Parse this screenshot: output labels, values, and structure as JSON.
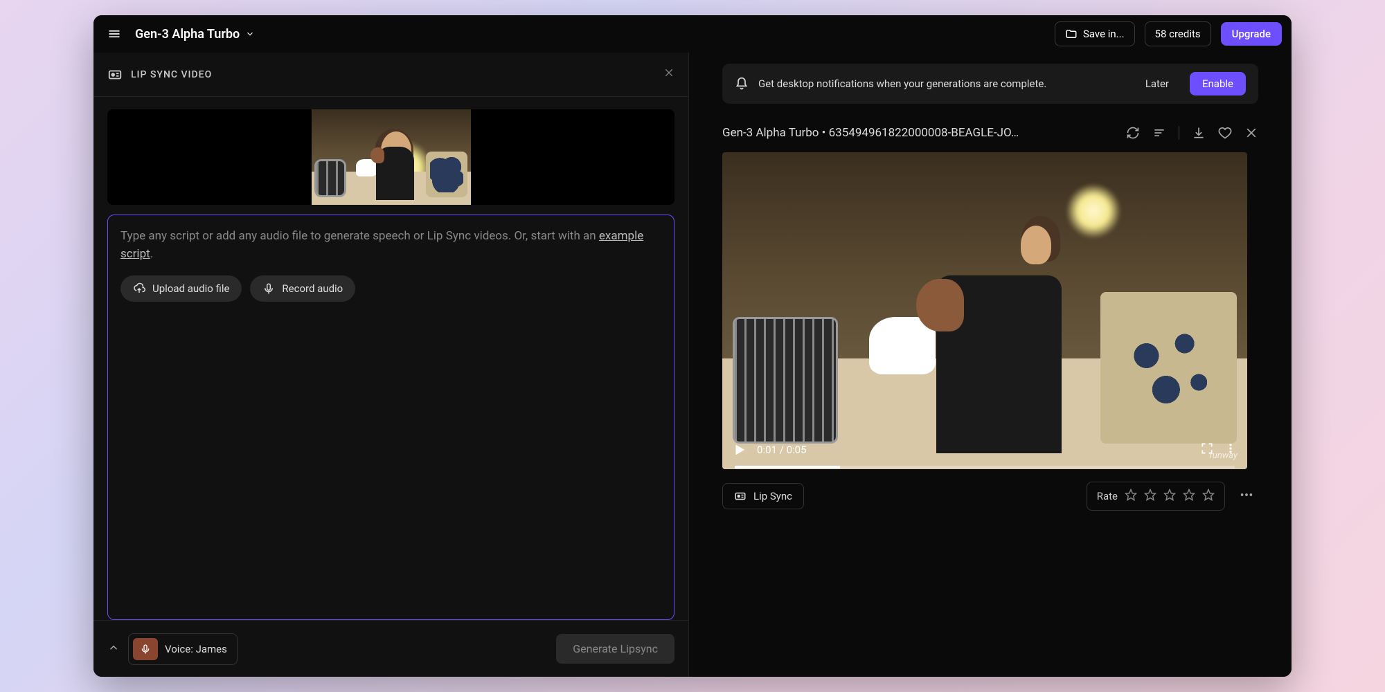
{
  "header": {
    "model": "Gen-3 Alpha Turbo",
    "save_label": "Save in...",
    "credits": "58 credits",
    "upgrade": "Upgrade"
  },
  "left": {
    "panel_title": "LIP SYNC VIDEO",
    "placeholder_pre": "Type any script or add any audio file to generate speech or Lip Sync videos. Or, start with an ",
    "placeholder_link": "example script",
    "placeholder_post": ".",
    "upload_audio": "Upload audio file",
    "record_audio": "Record audio",
    "voice_label": "Voice: James",
    "generate_label": "Generate Lipsync"
  },
  "notification": {
    "text": "Get desktop notifications when your generations are complete.",
    "later": "Later",
    "enable": "Enable"
  },
  "gen": {
    "title": "Gen-3 Alpha Turbo • 635494961822000008-BEAGLE-JO…",
    "time_current": "0:01",
    "time_total": "0:05",
    "watermark": "runway",
    "lipsync_btn": "Lip Sync",
    "rate_label": "Rate"
  }
}
